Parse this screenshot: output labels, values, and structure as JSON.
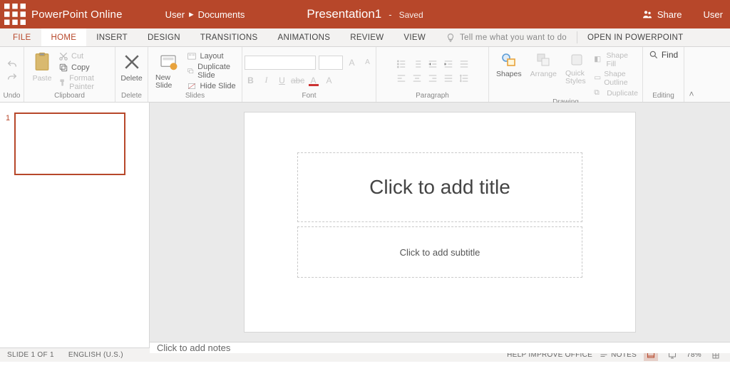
{
  "title_bar": {
    "app_name": "PowerPoint Online",
    "user": "User",
    "bc_sep": "▸",
    "bc_loc": "Documents",
    "doc_title": "Presentation1",
    "dash": "-",
    "saved": "Saved",
    "share": "Share",
    "right_user": "User"
  },
  "tabs": {
    "file": "FILE",
    "home": "HOME",
    "insert": "INSERT",
    "design": "DESIGN",
    "transitions": "TRANSITIONS",
    "animations": "ANIMATIONS",
    "review": "REVIEW",
    "view": "VIEW",
    "tellme": "Tell me what you want to do",
    "open": "OPEN IN POWERPOINT"
  },
  "ribbon": {
    "undo_label": "Undo",
    "clipboard": {
      "paste": "Paste",
      "cut": "Cut",
      "copy": "Copy",
      "painter": "Format Painter",
      "label": "Clipboard"
    },
    "delete": {
      "btn": "Delete",
      "label": "Delete"
    },
    "slides": {
      "new": "New Slide",
      "layout": "Layout",
      "dup": "Duplicate Slide",
      "hide": "Hide Slide",
      "label": "Slides"
    },
    "font_label": "Font",
    "para_label": "Paragraph",
    "drawing": {
      "shapes": "Shapes",
      "arrange": "Arrange",
      "quick": "Quick Styles",
      "fill": "Shape Fill",
      "outline": "Shape Outline",
      "dup": "Duplicate",
      "label": "Drawing"
    },
    "editing": {
      "find": "Find",
      "label": "Editing"
    }
  },
  "thumbs": {
    "n1": "1"
  },
  "slide": {
    "title_ph": "Click to add title",
    "sub_ph": "Click to add subtitle"
  },
  "notes": {
    "placeholder": "Click to add notes"
  },
  "status": {
    "slide": "SLIDE 1 OF 1",
    "lang": "ENGLISH (U.S.)",
    "help": "HELP IMPROVE OFFICE",
    "notes": "NOTES",
    "zoom": "78%"
  }
}
